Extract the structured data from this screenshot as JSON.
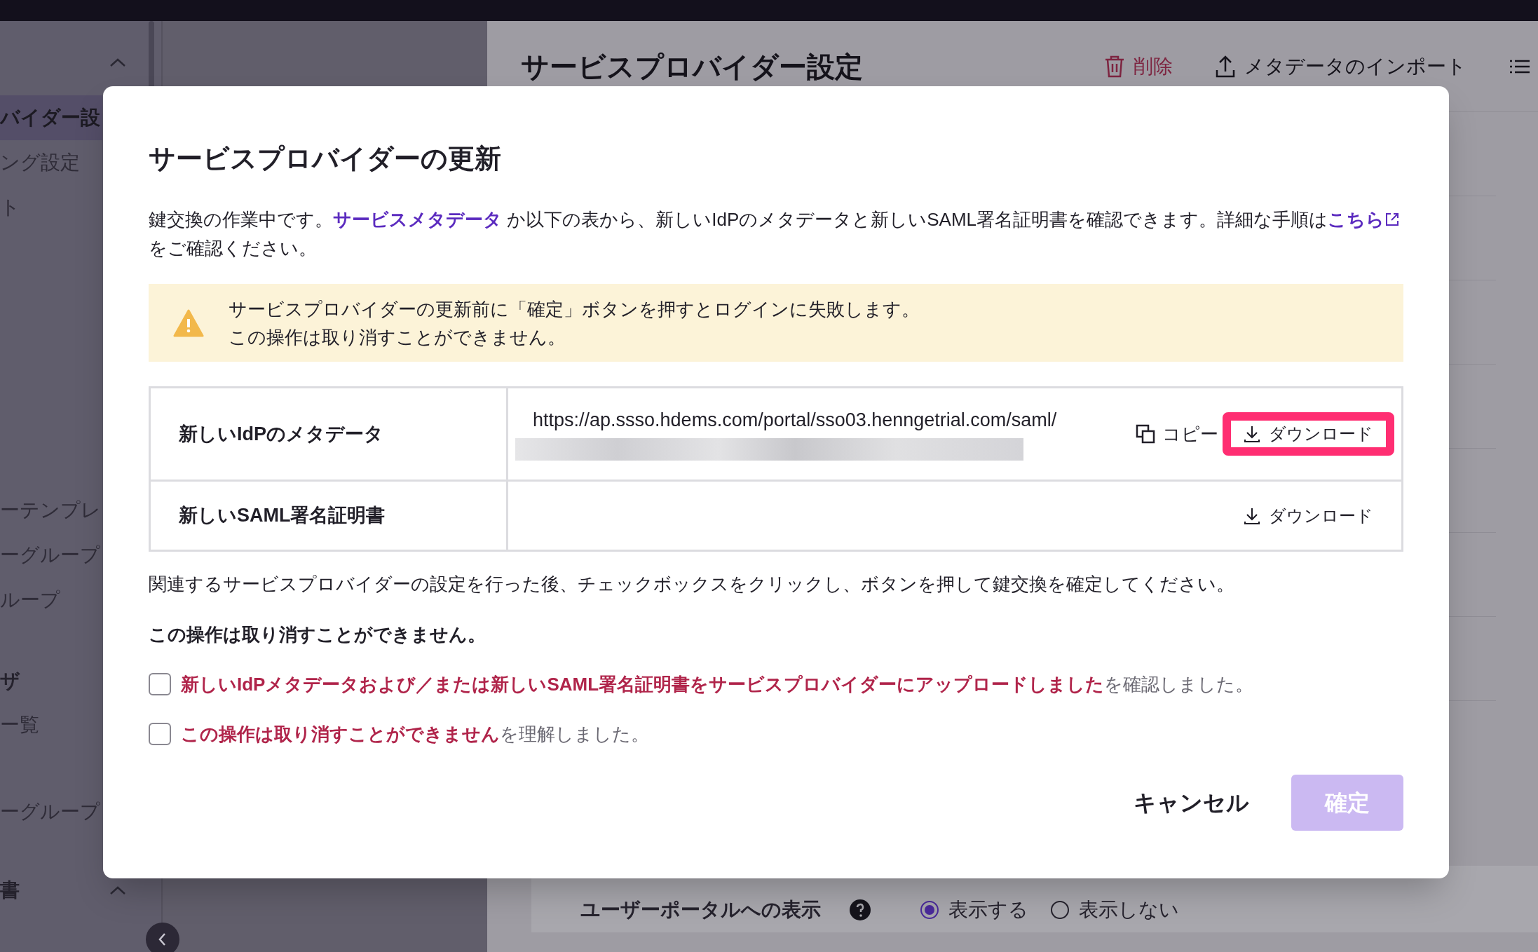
{
  "sidebar": {
    "sections": [
      {
        "items": [
          {
            "label": "バイダー設",
            "selected": true
          },
          {
            "label": "ング設定",
            "selected": false
          },
          {
            "label": "ト",
            "selected": false
          }
        ]
      },
      {
        "items": [
          {
            "label": "ーテンプレ",
            "selected": false
          },
          {
            "label": "ーグループ",
            "selected": false
          },
          {
            "label": "ループ",
            "selected": false
          }
        ]
      },
      {
        "heading": "ザ",
        "items": [
          {
            "label": "ー覧",
            "selected": false
          }
        ]
      },
      {
        "items": [
          {
            "label": "ーグループ",
            "selected": false
          }
        ]
      },
      {
        "heading": "書",
        "expanded": true
      }
    ]
  },
  "page": {
    "title": "サービスプロバイダー設定",
    "actions": [
      {
        "kind": "delete",
        "label": "削除"
      },
      {
        "kind": "import",
        "label": "メタデータのインポート"
      },
      {
        "kind": "menu"
      }
    ],
    "portal_row": {
      "label": "ユーザーポータルへの表示",
      "options": [
        {
          "label": "表示する",
          "selected": true
        },
        {
          "label": "表示しない",
          "selected": false
        }
      ]
    }
  },
  "dialog": {
    "title": "サービスプロバイダーの更新",
    "description": [
      {
        "kind": "text",
        "text": "鍵交換の作業中です。"
      },
      {
        "kind": "link",
        "text": "サービスメタデータ"
      },
      {
        "kind": "text",
        "text": " か以下の表から、新しいIdPのメタデータと新しいSAML署名証明書を確認できます。詳細な手順は"
      },
      {
        "kind": "external_link",
        "text": "こちら"
      },
      {
        "kind": "text",
        "text": "をご確認ください。"
      }
    ],
    "warning": [
      "サービスプロバイダーの更新前に「確定」ボタンを押すとログインに失敗します。",
      "この操作は取り消すことができません。"
    ],
    "table": {
      "rows": [
        {
          "label": "新しいIdPのメタデータ",
          "value": "https://ap.ssso.hdems.com/portal/sso03.henngetrial.com/saml/",
          "redacted": true,
          "copy": "コピー",
          "download": "ダウンロード",
          "highlighted": true
        },
        {
          "label": "新しいSAML署名証明書",
          "redacted": false,
          "download": "ダウンロード",
          "highlighted": false
        }
      ]
    },
    "instruction": "関連するサービスプロバイダーの設定を行った後、チェックボックスをクリックし、ボタンを押して鍵交換を確定してください。",
    "notice": "この操作は取り消すことができません。",
    "checkboxes": [
      {
        "label": "**新しいIdPメタデータおよび／または新しいSAML署名証明書をサービスプロバイダーにアップロードしました**を確認しました。",
        "checked": false
      },
      {
        "label": "**この操作は取り消すことができません**を理解しました。",
        "checked": false
      }
    ],
    "buttons": [
      {
        "kind": "cancel",
        "label": "キャンセル",
        "disabled": false
      },
      {
        "kind": "confirm",
        "label": "確定",
        "disabled": true
      }
    ]
  }
}
